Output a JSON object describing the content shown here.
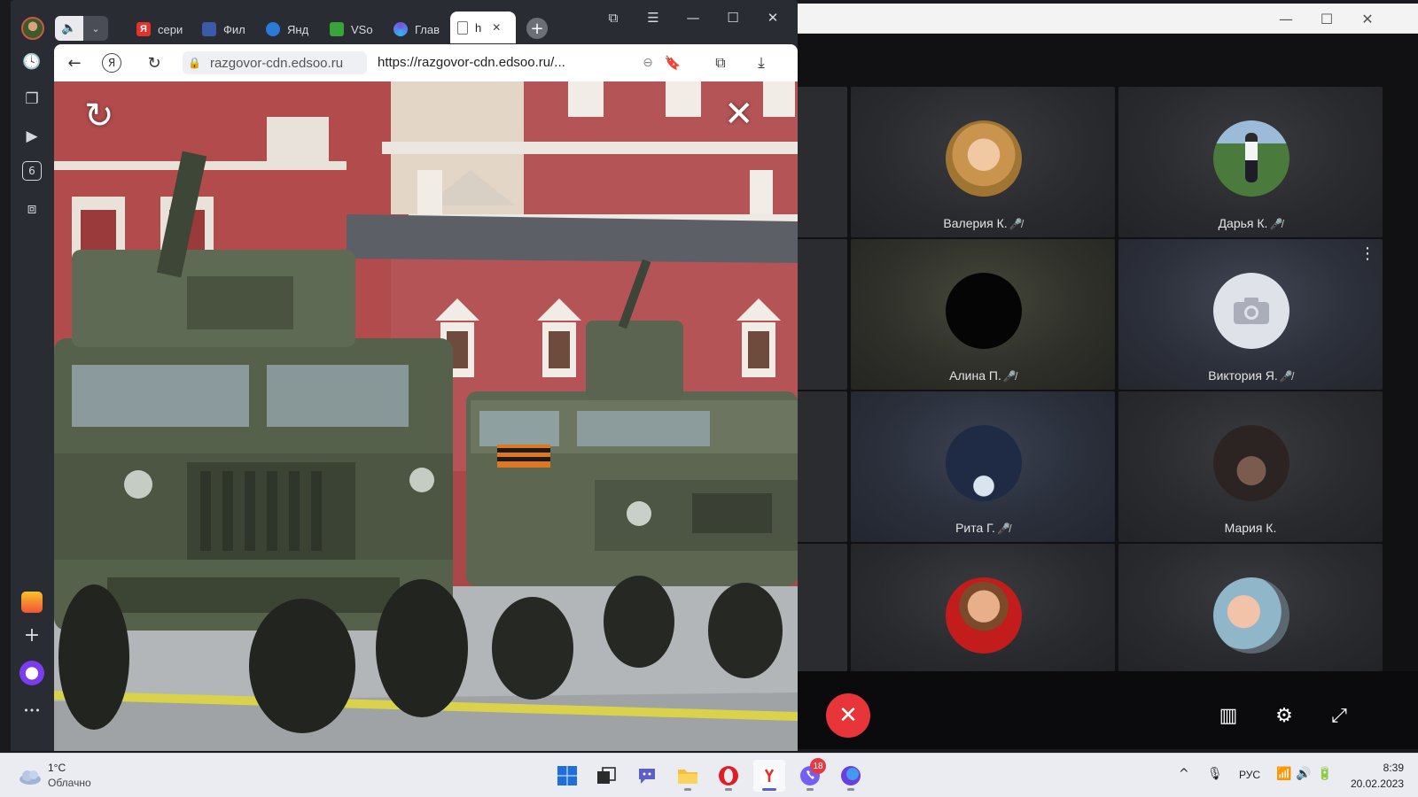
{
  "call": {
    "participants": [
      {
        "name": "Валерия К.",
        "muted": true
      },
      {
        "name": "Дарья К.",
        "muted": true
      },
      {
        "name": "Алина П.",
        "muted": true
      },
      {
        "name": "Виктория Я.",
        "muted": true
      },
      {
        "name": "Рита Г.",
        "muted": true
      },
      {
        "name": "Мария К.",
        "muted": false
      },
      {
        "name": "",
        "muted": false
      },
      {
        "name": "",
        "muted": false
      }
    ],
    "mic_off_glyph": "🎤̸",
    "tile_menu_glyph": "⋮",
    "hangup_glyph": "✕",
    "layout_glyph": "▥",
    "settings_glyph": "⚙",
    "fullscreen_glyph": "⤢",
    "minimize_glyph": "—",
    "maximize_glyph": "☐",
    "close_glyph": "✕",
    "colors": {
      "hangup": "#e7353a"
    }
  },
  "browser": {
    "tabs": [
      {
        "label": "сери",
        "favicon": "Я",
        "favicon_color": "#e2322b"
      },
      {
        "label": "Фил",
        "favicon": "🖼",
        "favicon_color": "#3b5ba8"
      },
      {
        "label": "Янд",
        "favicon": "~",
        "favicon_color": "#2b7ad8"
      },
      {
        "label": "VSo",
        "favicon": "▣",
        "favicon_color": "#3aa33a"
      },
      {
        "label": "Глав",
        "favicon": "◑",
        "favicon_color": "#7a4fe0"
      },
      {
        "label": "h",
        "favicon": "🗋",
        "favicon_color": "#ffffff"
      }
    ],
    "active_tab_close": "✕",
    "new_tab_glyph": "+",
    "domain": "razgovor-cdn.edsoo.ru",
    "url": "https://razgovor-cdn.edsoo.ru/...",
    "back_glyph": "←",
    "yandex_glyph": "Я",
    "reload_glyph": "↻",
    "lock_glyph": "🔒",
    "sidebar_badge": "6",
    "more_glyph": "•••",
    "video": {
      "replay_glyph": "↻",
      "close_glyph": "✕"
    }
  },
  "taskbar": {
    "temperature": "1°C",
    "weather": "Облачно",
    "language": "РУС",
    "time": "8:39",
    "date": "20.02.2023",
    "viber_badge": "18"
  }
}
